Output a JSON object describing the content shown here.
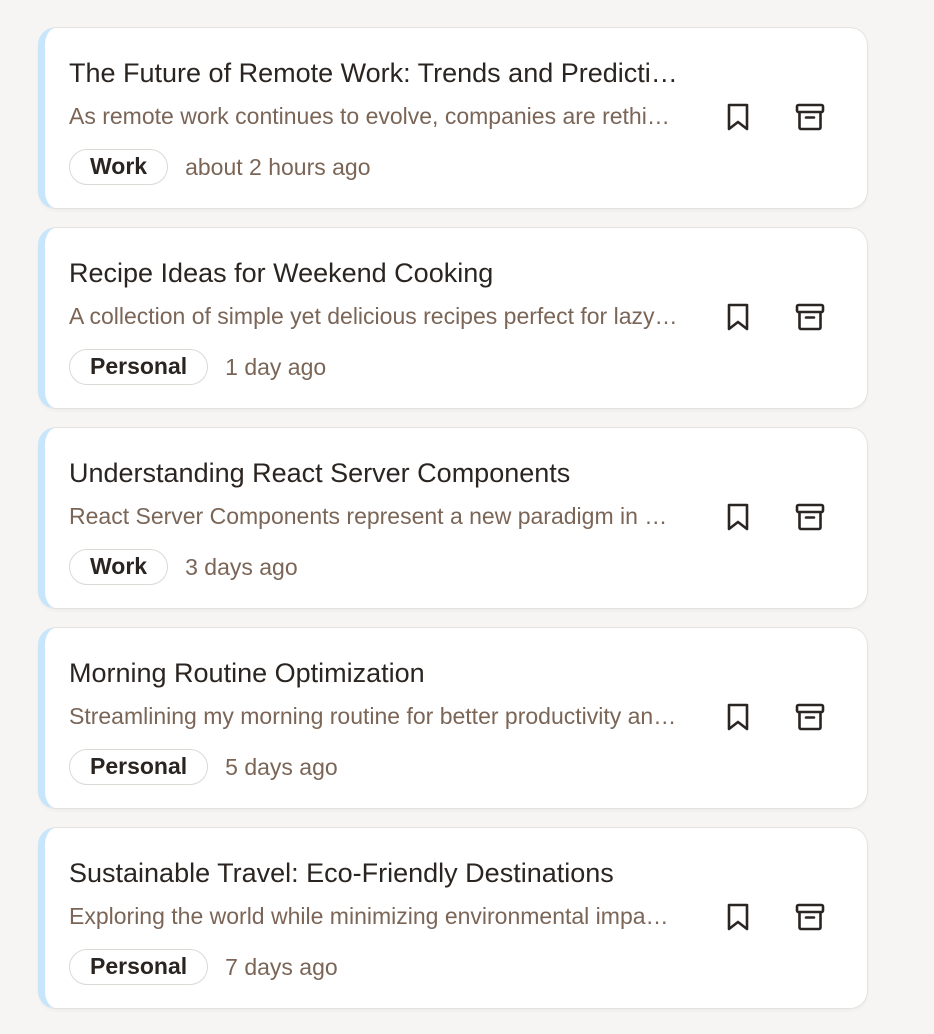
{
  "notes": [
    {
      "title": "The Future of Remote Work: Trends and Predictions",
      "preview": "As remote work continues to evolve, companies are rethinking how they hire and collaborate",
      "tag": "Work",
      "time": "about 2 hours ago"
    },
    {
      "title": "Recipe Ideas for Weekend Cooking",
      "preview": "A collection of simple yet delicious recipes perfect for lazy weekends",
      "tag": "Personal",
      "time": "1 day ago"
    },
    {
      "title": "Understanding React Server Components",
      "preview": "React Server Components represent a new paradigm in building React applications",
      "tag": "Work",
      "time": "3 days ago"
    },
    {
      "title": "Morning Routine Optimization",
      "preview": "Streamlining my morning routine for better productivity and focus",
      "tag": "Personal",
      "time": "5 days ago"
    },
    {
      "title": "Sustainable Travel: Eco-Friendly Destinations",
      "preview": "Exploring the world while minimizing environmental impact on every trip",
      "tag": "Personal",
      "time": "7 days ago"
    }
  ],
  "icons": {
    "bookmark": "bookmark-icon",
    "archive": "archive-icon"
  },
  "colors": {
    "accent_border": "#c7e6fb",
    "title": "#2b2521",
    "muted_text": "#7a6557"
  }
}
